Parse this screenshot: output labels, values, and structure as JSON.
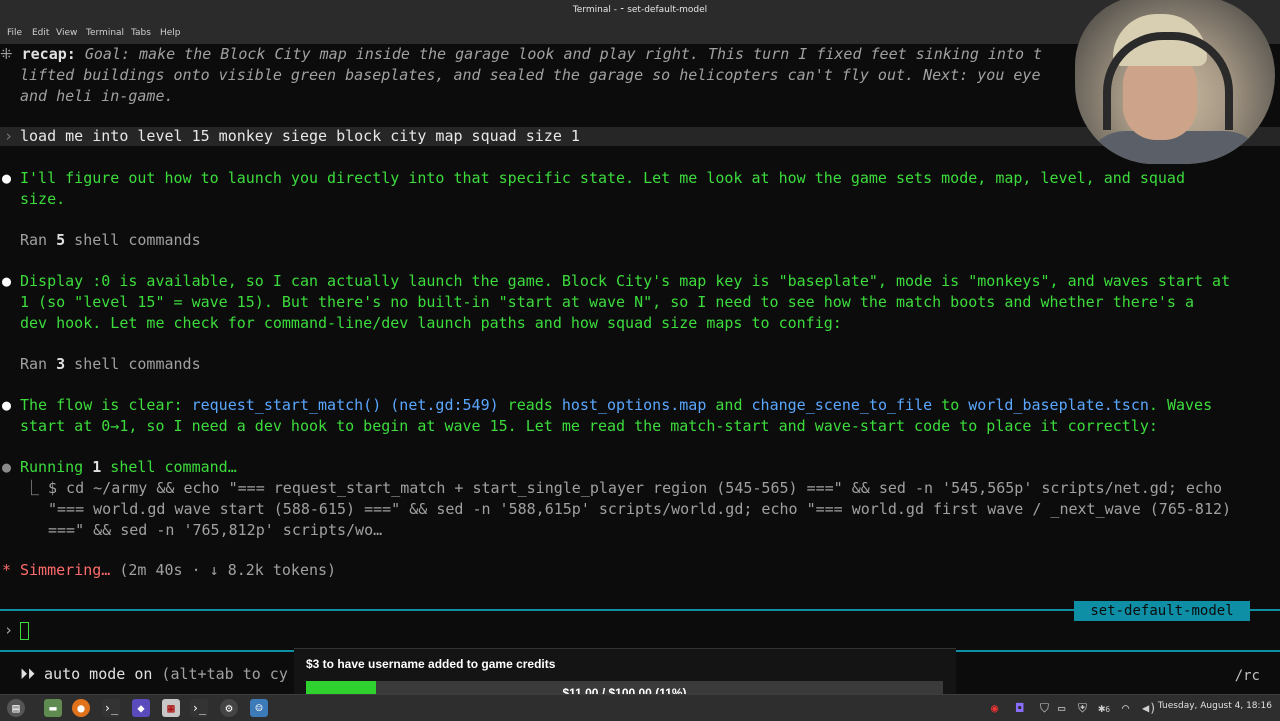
{
  "window": {
    "title": "Terminal - ⁃ set-default-model"
  },
  "menu": [
    "File",
    "Edit",
    "View",
    "Terminal",
    "Tabs",
    "Help"
  ],
  "recap": {
    "label": "recap:",
    "lines": [
      "Goal: make the Block City map inside the garage look and play right. This turn I fixed feet sinking into t",
      "lifted buildings onto visible green baseplates, and sealed the garage so helicopters can't fly out. Next: you eye",
      "and heli in-game."
    ]
  },
  "user_prompt": "load me into level 15 monkey siege block city map squad size 1",
  "messages": {
    "m1_line1": "I'll figure out how to launch you directly into that specific state. Let me look at how the game sets mode, map, level, and squad",
    "m1_line2": "size.",
    "ran1_prefix": "Ran ",
    "ran1_count": "5",
    "ran1_suffix": " shell commands",
    "m2_line1": "Display :0 is available, so I can actually launch the game. Block City's map key is \"baseplate\", mode is \"monkeys\", and waves start at",
    "m2_line2": "1 (so \"level 15\" = wave 15). But there's no built-in \"start at wave N\", so I need to see how the match boots and whether there's a",
    "m2_line3": "dev hook. Let me check for command-line/dev launch paths and how squad size maps to config:",
    "ran2_prefix": "Ran ",
    "ran2_count": "3",
    "ran2_suffix": " shell commands",
    "m3_a": "The flow is clear: ",
    "m3_b": "request_start_match()",
    "m3_c": " ",
    "m3_d": "(net.gd:549)",
    "m3_e": " reads ",
    "m3_f": "host_options.map",
    "m3_g": " and ",
    "m3_h": "change_scene_to_file",
    "m3_i": " to ",
    "m3_j": "world_baseplate.tscn",
    "m3_k": ". Waves",
    "m3_line2": "start at 0→1, so I need a dev hook to begin at wave 15. Let me read the match-start and wave-start code to place it correctly:",
    "running_prefix": "Running ",
    "running_count": "1",
    "running_suffix": " shell command…",
    "cmd_line1": "$ cd ~/army && echo \"=== request_start_match + start_single_player region (545-565) ===\" && sed -n '545,565p' scripts/net.gd; echo",
    "cmd_line2": "\"=== world.gd wave start (588-615) ===\" && sed -n '588,615p' scripts/world.gd; echo \"=== world.gd first wave / _next_wave (765-812)",
    "cmd_line3": "===\" && sed -n '765,812p' scripts/wo…",
    "status_label": "Simmering…",
    "status_detail": " (2m 40s · ↓ 8.2k tokens)"
  },
  "model_tag": "set-default-model",
  "auto_mode": {
    "label": "auto mode on",
    "hint": " (alt+tab to cy"
  },
  "rc_label": "/rc",
  "overlay": {
    "title": "$3 to have username added to game credits",
    "progress_text": "$11.00 / $100.00 (11%)",
    "progress_fraction": 0.11
  },
  "taskbar": {
    "clock": "Tuesday, August  4, 18:16",
    "badge": "6"
  },
  "colors": {
    "accent": "#0e8fa6",
    "green_text": "#3cdc3c",
    "progress": "#2fd12f"
  }
}
